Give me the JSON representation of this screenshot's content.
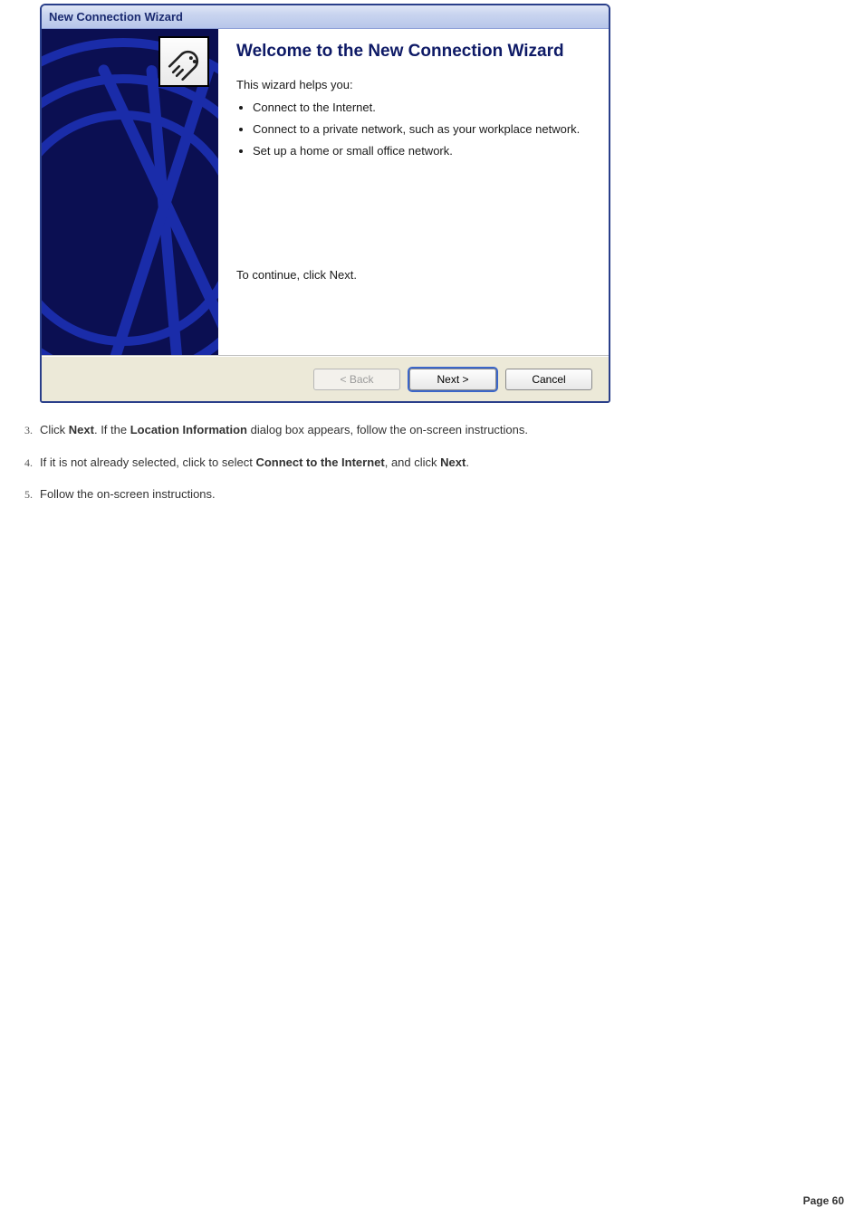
{
  "dialog": {
    "title": "New Connection Wizard",
    "heading": "Welcome to the New Connection Wizard",
    "intro": "This wizard helps you:",
    "bullets": [
      "Connect to the Internet.",
      "Connect to a private network, such as your workplace network.",
      "Set up a home or small office network."
    ],
    "continue_text": "To continue, click Next.",
    "buttons": {
      "back": "< Back",
      "next": "Next >",
      "cancel": "Cancel"
    }
  },
  "instructions": [
    {
      "n": "3.",
      "pre": "Click ",
      "b1": "Next",
      "mid": ". If the ",
      "b2": "Location Information",
      "post": " dialog box appears, follow the on-screen instructions."
    },
    {
      "n": "4.",
      "pre": "If it is not already selected, click to select ",
      "b1": "Connect to the Internet",
      "mid": ", and click ",
      "b2": "Next",
      "post": "."
    },
    {
      "n": "5.",
      "pre": "Follow the on-screen instructions.",
      "b1": "",
      "mid": "",
      "b2": "",
      "post": ""
    }
  ],
  "page_label": "Page 60"
}
